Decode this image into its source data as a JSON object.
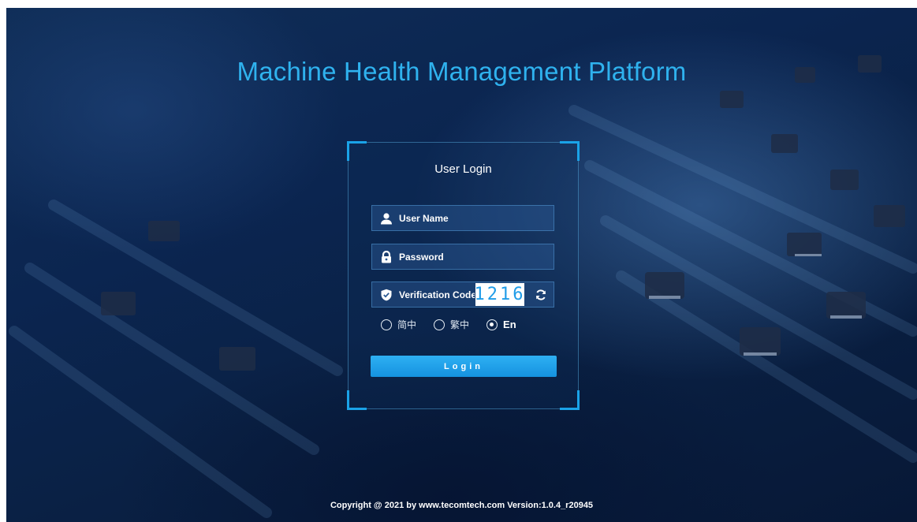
{
  "page": {
    "title": "Machine Health Management Platform"
  },
  "login": {
    "heading": "User Login",
    "username_placeholder": "User Name",
    "password_placeholder": "Password",
    "verification_placeholder": "Verification Code",
    "captcha_value": "1216",
    "languages": [
      {
        "label": "简中",
        "selected": false
      },
      {
        "label": "繁中",
        "selected": false
      },
      {
        "label": "En",
        "selected": true
      }
    ],
    "submit_label": "Login"
  },
  "footer": {
    "copyright": "Copyright @ 2021 by www.tecomtech.com Version:1.0.4_r20945"
  },
  "colors": {
    "accent": "#2fb2ee",
    "button": "#1a9fe8",
    "background": "#0b2550"
  },
  "icons": [
    "user-icon",
    "lock-icon",
    "shield-check-icon",
    "refresh-icon"
  ]
}
